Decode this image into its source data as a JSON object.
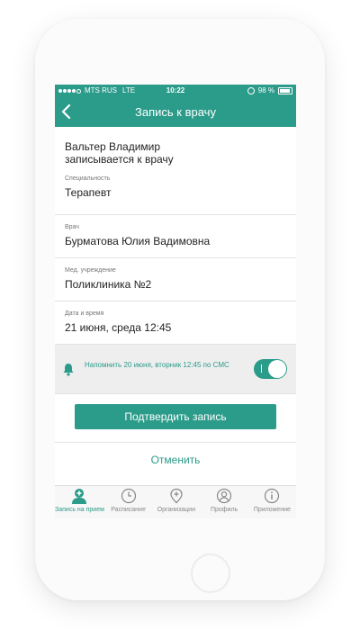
{
  "status_bar": {
    "carrier": "MTS RUS",
    "network": "LTE",
    "time": "10:22",
    "battery": "98 %"
  },
  "header": {
    "title": "Запись к врачу"
  },
  "patient": {
    "name": "Вальтер Владимир",
    "action": "записывается к врачу"
  },
  "specialty": {
    "label": "Специальность",
    "value": "Терапевт"
  },
  "doctor": {
    "label": "Врач",
    "value": "Бурматова Юлия Вадимовна"
  },
  "institution": {
    "label": "Мед. учреждение",
    "value": "Поликлиника №2"
  },
  "datetime": {
    "label": "Дата и время",
    "value": "21 июня, среда 12:45"
  },
  "reminder": {
    "text": "Напомнить 20 июня, вторник 12:45  по СМС",
    "enabled": true
  },
  "actions": {
    "confirm": "Подтвердить запись",
    "cancel": "Отменить"
  },
  "tabs": [
    {
      "label": "Запись на прием",
      "icon": "doctor-icon",
      "active": true
    },
    {
      "label": "Расписание",
      "icon": "clock-icon",
      "active": false
    },
    {
      "label": "Организации",
      "icon": "location-pin-icon",
      "active": false
    },
    {
      "label": "Профиль",
      "icon": "person-icon",
      "active": false
    },
    {
      "label": "Приложение",
      "icon": "info-icon",
      "active": false
    }
  ],
  "colors": {
    "accent": "#2b9b8a",
    "reminder_bg": "#eeeeee",
    "tab_inactive": "#888888"
  }
}
